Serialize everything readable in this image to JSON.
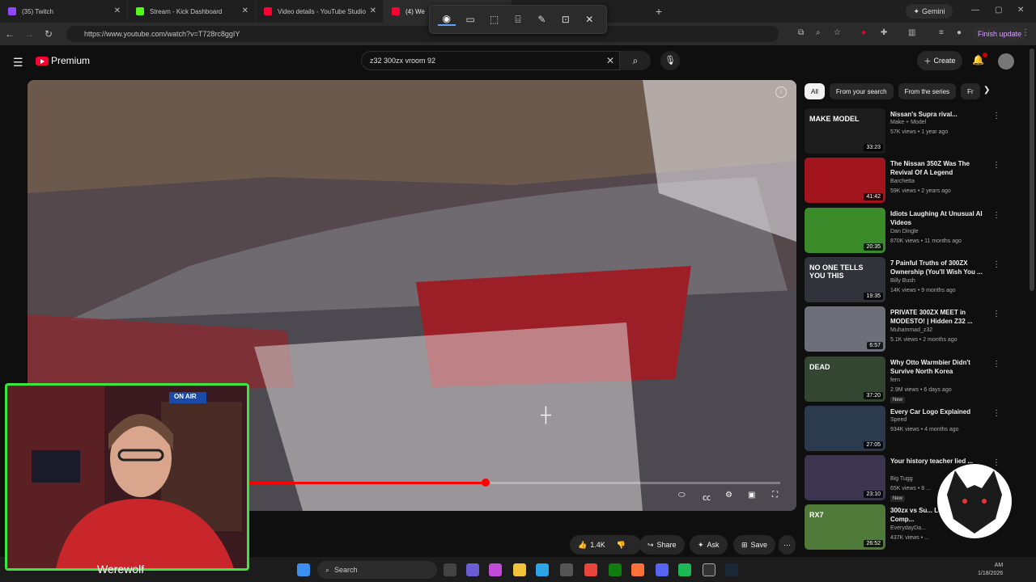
{
  "browser": {
    "tabs": [
      {
        "title": "(35) Twitch",
        "color": "#9146ff"
      },
      {
        "title": "Stream - Kick Dashboard",
        "color": "#53fc18"
      },
      {
        "title": "Video details - YouTube Studio",
        "color": "#ff0033"
      },
      {
        "title": "(4) We",
        "color": "#ff0033"
      }
    ],
    "gemini_label": "Gemini",
    "url": "https://www.youtube.com/watch?v=T728rc8ggIY",
    "finish_update": "Finish update"
  },
  "youtube": {
    "logo_text": "Premium",
    "search_value": "z32 300zx vroom  92",
    "create_label": "Create"
  },
  "player": {
    "progress": 0.6
  },
  "actions": {
    "likes": "1.4K",
    "share": "Share",
    "ask": "Ask",
    "save": "Save"
  },
  "chips": [
    "All",
    "From your search",
    "From the series",
    "Fr"
  ],
  "recommendations": [
    {
      "title": "Nissan's Supra rival...",
      "channel": "Make + Model",
      "meta": "57K views • 1 year ago",
      "duration": "33:23",
      "thumb": "#1d1d1d",
      "thumb_text": "MAKE MODEL"
    },
    {
      "title": "The Nissan 350Z Was The Revival Of A Legend",
      "channel": "Barchetta",
      "meta": "59K views • 2 years ago",
      "duration": "41:42",
      "thumb": "#a3151c",
      "thumb_text": ""
    },
    {
      "title": "Idiots Laughing At Unusual AI Videos",
      "channel": "Dan Dingle",
      "meta": "870K views • 11 months ago",
      "duration": "20:35",
      "thumb": "#3b8b2a",
      "thumb_text": ""
    },
    {
      "title": "7 Painful Truths of 300ZX Ownership (You'll Wish You ...",
      "channel": "Billy Bush",
      "meta": "14K views • 9 months ago",
      "duration": "19:35",
      "thumb": "#31323a",
      "thumb_text": "NO ONE TELLS YOU THIS"
    },
    {
      "title": "PRIVATE 300ZX MEET in MODESTO! | Hidden Z32 ...",
      "channel": "Muhammad_z32",
      "meta": "5.1K views • 2 months ago",
      "duration": "6:57",
      "thumb": "#6d7078",
      "thumb_text": ""
    },
    {
      "title": "Why Otto Warmbier Didn't Survive North Korea",
      "channel": "fern",
      "meta": "2.9M views • 6 days ago",
      "duration": "37:20",
      "thumb": "#324632",
      "thumb_text": "DEAD",
      "badge": "New"
    },
    {
      "title": "Every Car Logo Explained",
      "channel": "Speed",
      "meta": "934K views • 4 months ago",
      "duration": "27:05",
      "thumb": "#2b3a4c",
      "thumb_text": ""
    },
    {
      "title": "Your history teacher lied ...",
      "channel": "Big Tugg",
      "meta": "65K views • 8 ...",
      "duration": "23:10",
      "thumb": "#3b3550",
      "thumb_text": "",
      "badge": "New"
    },
    {
      "title": "300zx vs Su... Legends Comp...",
      "channel": "EverydayDa...",
      "meta": "437K views • ...",
      "duration": "26:52",
      "thumb": "#4f7a3a",
      "thumb_text": "RX7"
    }
  ],
  "webcam": {
    "name": "Werewolf",
    "sign": "ON AIR",
    "overlay_logo": "WEREWOLF TV"
  },
  "taskbar": {
    "search_placeholder": "Search",
    "date": "1/18/2026",
    "time": "AM"
  }
}
